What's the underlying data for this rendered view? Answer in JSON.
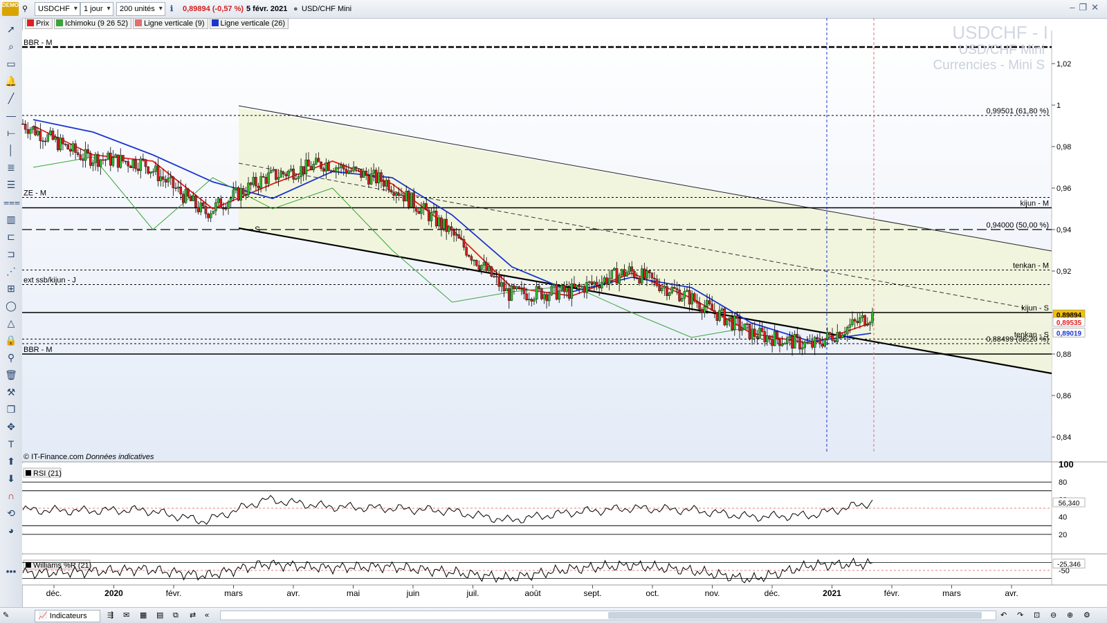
{
  "topbar": {
    "demo_badge": "DEMO",
    "symbol": "USDCHF",
    "period": "1 jour",
    "units": "200 unités",
    "quote": "0,89894 (-0,57 %)",
    "date": "5 févr. 2021",
    "instrument": "USD/CHF Mini"
  },
  "legend": [
    {
      "label": "Prix",
      "color": "#e02020"
    },
    {
      "label": "Ichimoku (9 26 52)",
      "color": "#3aa43a"
    },
    {
      "label": "Ligne verticale (9)",
      "color": "#e07070"
    },
    {
      "label": "Ligne verticale (26)",
      "color": "#1a35d0"
    }
  ],
  "watermark": {
    "line1": "USDCHF - I",
    "line2": "USD/CHF Mini",
    "line3": "Currencies - Mini S"
  },
  "credit": {
    "source": "© IT-Finance.com",
    "note": "Données indicatives"
  },
  "price_lines": [
    {
      "label": "BBR - M",
      "value": 1.028,
      "style": "dash-heavy",
      "side": "left"
    },
    {
      "label": "0,99501 (61,80 %)",
      "value": 0.99501,
      "style": "dotted",
      "side": "right"
    },
    {
      "label": "ZE - M",
      "value": 0.9555,
      "style": "dotted",
      "side": "left"
    },
    {
      "label": "kijun - M",
      "value": 0.9505,
      "style": "solid",
      "side": "right"
    },
    {
      "label": "0,94000 (50,00 %)",
      "value": 0.94,
      "style": "dashed",
      "side": "right"
    },
    {
      "label": "tenkan - M",
      "value": 0.9205,
      "style": "dotted",
      "side": "right"
    },
    {
      "label": "ext ssb/kijun - J",
      "value": 0.9135,
      "style": "dotted",
      "side": "left"
    },
    {
      "label": "kijun - S",
      "value": 0.9,
      "style": "solid",
      "side": "right"
    },
    {
      "label": "tenkan - S",
      "value": 0.8872,
      "style": "dotted",
      "side": "right"
    },
    {
      "label": "0,88499 (38,20 %)",
      "value": 0.885,
      "style": "dotted",
      "side": "right"
    },
    {
      "label": "BBR - M",
      "value": 0.88,
      "style": "solid",
      "side": "left"
    }
  ],
  "value_badges": [
    {
      "label": "0,89894",
      "value": 0.89894,
      "bg": "#f5c000",
      "fg": "#000000"
    },
    {
      "label": "0,89535",
      "value": 0.89535,
      "bg": "#ffffff",
      "fg": "#e02020"
    },
    {
      "label": "0,89019",
      "value": 0.89019,
      "bg": "#ffffff",
      "fg": "#1a35d0"
    }
  ],
  "channel": {
    "s_label": "S"
  },
  "chart_data": [
    {
      "type": "line",
      "title": "USDCHF - I",
      "xlabel": "",
      "ylabel": "",
      "ylim": [
        0.828,
        1.036
      ],
      "x_ticks": [
        "déc.",
        "2020",
        "févr.",
        "mars",
        "avr.",
        "mai",
        "juin",
        "juil.",
        "août",
        "sept.",
        "oct.",
        "nov.",
        "déc.",
        "2021",
        "févr.",
        "mars",
        "avr."
      ],
      "y_ticks": [
        "1,02",
        "1",
        "0,98",
        "0,96",
        "0,94",
        "0,92",
        "0,90",
        "0,88",
        "0,86",
        "0,84"
      ],
      "grid": false,
      "series": [
        {
          "name": "Prix",
          "color": "#000000",
          "x": [
            "déc.",
            "2020",
            "févr.",
            "mars",
            "avr.",
            "mai",
            "juin",
            "juil.",
            "août",
            "sept.",
            "oct.",
            "nov.",
            "déc.",
            "2021",
            "févr."
          ],
          "values": [
            0.991,
            0.975,
            0.972,
            0.948,
            0.965,
            0.972,
            0.963,
            0.94,
            0.909,
            0.91,
            0.92,
            0.907,
            0.89,
            0.884,
            0.899
          ]
        },
        {
          "name": "Tenkan",
          "color": "#e02020",
          "x": [
            "déc.",
            "2020",
            "févr.",
            "mars",
            "avr.",
            "mai",
            "juin",
            "juil.",
            "août",
            "sept.",
            "oct.",
            "nov.",
            "déc.",
            "2021",
            "févr."
          ],
          "values": [
            0.99,
            0.976,
            0.973,
            0.95,
            0.962,
            0.973,
            0.962,
            0.94,
            0.912,
            0.908,
            0.919,
            0.907,
            0.89,
            0.885,
            0.895
          ]
        },
        {
          "name": "Kijun",
          "color": "#1a35d0",
          "x": [
            "déc.",
            "2020",
            "févr.",
            "mars",
            "avr.",
            "mai",
            "juin",
            "juil.",
            "août",
            "sept.",
            "oct.",
            "nov.",
            "déc.",
            "2021",
            "févr."
          ],
          "values": [
            0.993,
            0.987,
            0.976,
            0.963,
            0.955,
            0.968,
            0.965,
            0.947,
            0.922,
            0.91,
            0.917,
            0.912,
            0.895,
            0.886,
            0.89
          ]
        },
        {
          "name": "Chikou",
          "color": "#3aa43a",
          "x": [
            "déc.",
            "2020",
            "févr.",
            "mars",
            "avr.",
            "mai",
            "juin",
            "juil.",
            "août",
            "sept.",
            "oct.",
            "nov.",
            "déc."
          ],
          "values": [
            0.97,
            0.975,
            0.94,
            0.965,
            0.95,
            0.96,
            0.93,
            0.905,
            0.91,
            0.913,
            0.9,
            0.888,
            0.893
          ]
        }
      ]
    },
    {
      "type": "line",
      "title": "RSI (21)",
      "ylim": [
        0,
        100
      ],
      "y_ticks": [
        "100",
        "80",
        "60",
        "40",
        "20"
      ],
      "current": "56,340",
      "series": [
        {
          "name": "RSI (21)",
          "color": "#000000",
          "x": [
            "déc.",
            "2020",
            "févr.",
            "mars",
            "avr.",
            "mai",
            "juin",
            "juil.",
            "août",
            "sept.",
            "oct.",
            "nov.",
            "déc.",
            "2021",
            "févr."
          ],
          "values": [
            48,
            47,
            48,
            35,
            60,
            52,
            50,
            47,
            36,
            45,
            50,
            48,
            40,
            42,
            57
          ]
        }
      ]
    },
    {
      "type": "line",
      "title": "Williams %R (21)",
      "ylim": [
        -100,
        0
      ],
      "y_ticks": [
        "-50"
      ],
      "current": "-25,346",
      "series": [
        {
          "name": "Williams %R (21)",
          "color": "#000000",
          "x": [
            "déc.",
            "2020",
            "févr.",
            "mars",
            "avr.",
            "mai",
            "juin",
            "juil.",
            "août",
            "sept.",
            "oct.",
            "nov.",
            "déc.",
            "2021",
            "févr."
          ],
          "values": [
            -60,
            -55,
            -45,
            -70,
            -25,
            -40,
            -35,
            -55,
            -80,
            -45,
            -30,
            -50,
            -85,
            -30,
            -25
          ]
        }
      ]
    }
  ],
  "bottombar": {
    "indicators_label": "Indicateurs"
  }
}
